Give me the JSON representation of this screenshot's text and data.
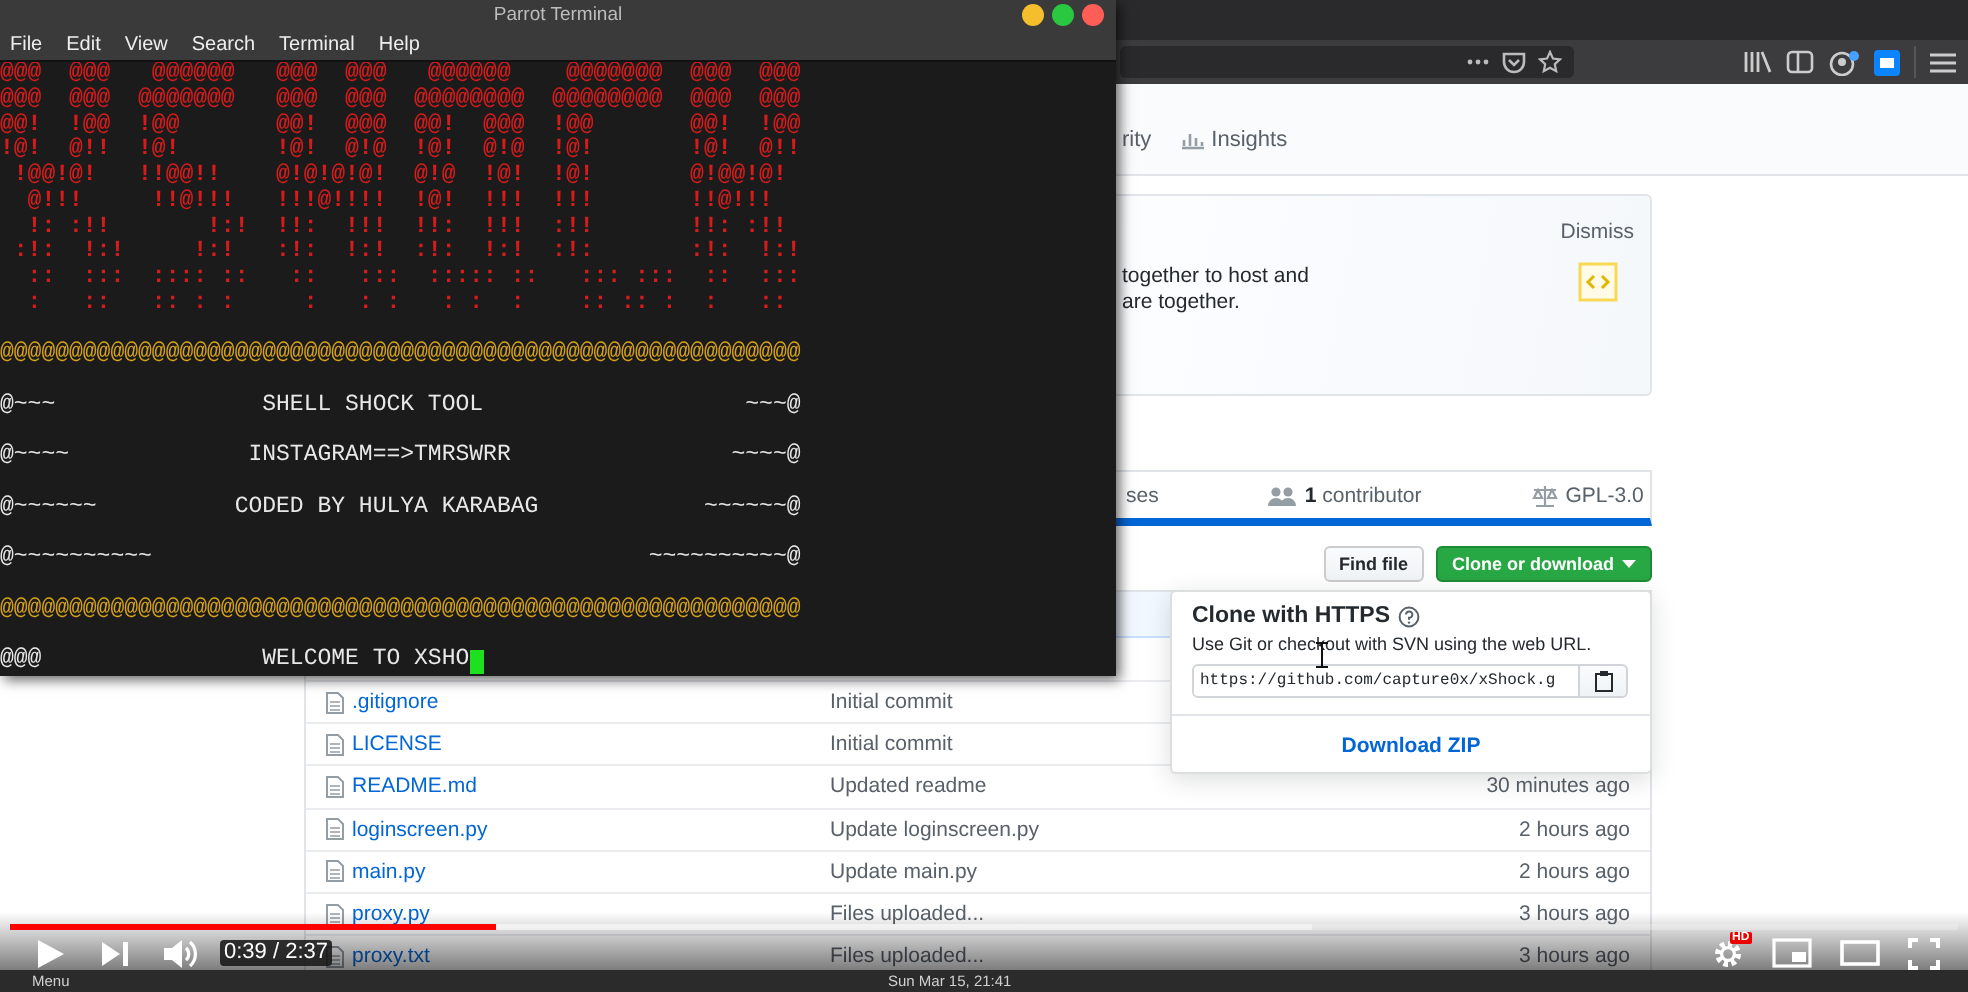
{
  "terminal": {
    "title": "Parrot Terminal",
    "menu": [
      "File",
      "Edit",
      "View",
      "Search",
      "Terminal",
      "Help"
    ],
    "lines": [
      {
        "kind": "art",
        "text": "@@@  @@@   @@@@@@   @@@  @@@   @@@@@@    @@@@@@@  @@@  @@@"
      },
      {
        "kind": "art",
        "text": "@@@  @@@  @@@@@@@   @@@  @@@  @@@@@@@@  @@@@@@@@  @@@  @@@"
      },
      {
        "kind": "art",
        "text": "@@!  !@@  !@@       @@!  @@@  @@!  @@@  !@@       @@!  !@@"
      },
      {
        "kind": "art",
        "text": "!@!  @!!  !@!       !@!  @!@  !@!  @!@  !@!       !@!  @!!"
      },
      {
        "kind": "art",
        "text": " !@@!@!   !!@@!!    @!@!@!@!  @!@  !@!  !@!       @!@@!@! "
      },
      {
        "kind": "art",
        "text": "  @!!!     !!@!!!   !!!@!!!!  !@!  !!!  !!!       !!@!!!  "
      },
      {
        "kind": "art",
        "text": "  !: :!!       !:!  !!:  !!!  !!:  !!!  :!!       !!: :!! "
      },
      {
        "kind": "art",
        "text": " :!:  !:!     !:!   :!:  !:!  :!:  !:!  :!:       :!:  !:!"
      },
      {
        "kind": "art",
        "text": "  ::  :::  :::: ::   ::   :::  ::::: ::   ::: :::  ::  :::"
      },
      {
        "kind": "art",
        "text": "  :   ::   :: : :     :   : :   : :  :    :: :: :  :   :: "
      },
      {
        "kind": "border",
        "text": "@@@@@@@@@@@@@@@@@@@@@@@@@@@@@@@@@@@@@@@@@@@@@@@@@@@@@@@@@@"
      },
      {
        "kind": "text",
        "text": "@~~~               SHELL SHOCK TOOL                   ~~~@"
      },
      {
        "kind": "text",
        "text": "@~~~~             INSTAGRAM==>TMRSWRR                ~~~~@"
      },
      {
        "kind": "text",
        "text": "@~~~~~~          CODED BY HULYA KARABAG            ~~~~~~@"
      },
      {
        "kind": "text",
        "text": "@~~~~~~~~~~                                    ~~~~~~~~~~@"
      },
      {
        "kind": "border",
        "text": "@@@@@@@@@@@@@@@@@@@@@@@@@@@@@@@@@@@@@@@@@@@@@@@@@@@@@@@@@@"
      },
      {
        "kind": "prompt",
        "text": "@@@                WELCOME TO XSHO"
      }
    ]
  },
  "github": {
    "nav": [
      {
        "kind": "plain",
        "label": "rity"
      },
      {
        "kind": "graph",
        "label": "Insights"
      }
    ],
    "banner": {
      "lines": [
        "together to host and",
        "are together."
      ],
      "dismiss": "Dismiss"
    },
    "stats": [
      {
        "kind": "plain",
        "label": "ses"
      },
      {
        "kind": "people",
        "label": "**1** contributor"
      },
      {
        "kind": "law",
        "label": "GPL-3.0"
      }
    ],
    "find_file": "Find file",
    "clone_button": "Clone or download",
    "files": [
      {
        "name": ".gitignore",
        "message": "Initial commit"
      },
      {
        "name": "LICENSE",
        "message": "Initial commit"
      },
      {
        "name": "README.md",
        "message": "Updated readme",
        "age": "30 minutes ago"
      },
      {
        "name": "loginscreen.py",
        "message": "Update loginscreen.py",
        "age": "2 hours ago"
      },
      {
        "name": "main.py",
        "message": "Update main.py",
        "age": "2 hours ago"
      },
      {
        "name": "proxy.py",
        "message": "Files uploaded...",
        "age": "3 hours ago"
      },
      {
        "name": "proxy.txt",
        "message": "Files uploaded...",
        "age": "3 hours ago"
      }
    ],
    "clone_popup": {
      "title": "Clone with HTTPS",
      "description": "Use Git or checkout with SVN using the web URL.",
      "url": "https://github.com/capture0x/xShock.g",
      "download": "Download ZIP"
    }
  },
  "player": {
    "progress": {
      "level": 0.249,
      "buffered": {
        "level": 0.668
      }
    },
    "time": "0:39 / 2:37",
    "quality_badge": "HD"
  },
  "taskbar": {
    "menu": "Menu",
    "clock": "Sun Mar 15, 21:41"
  }
}
